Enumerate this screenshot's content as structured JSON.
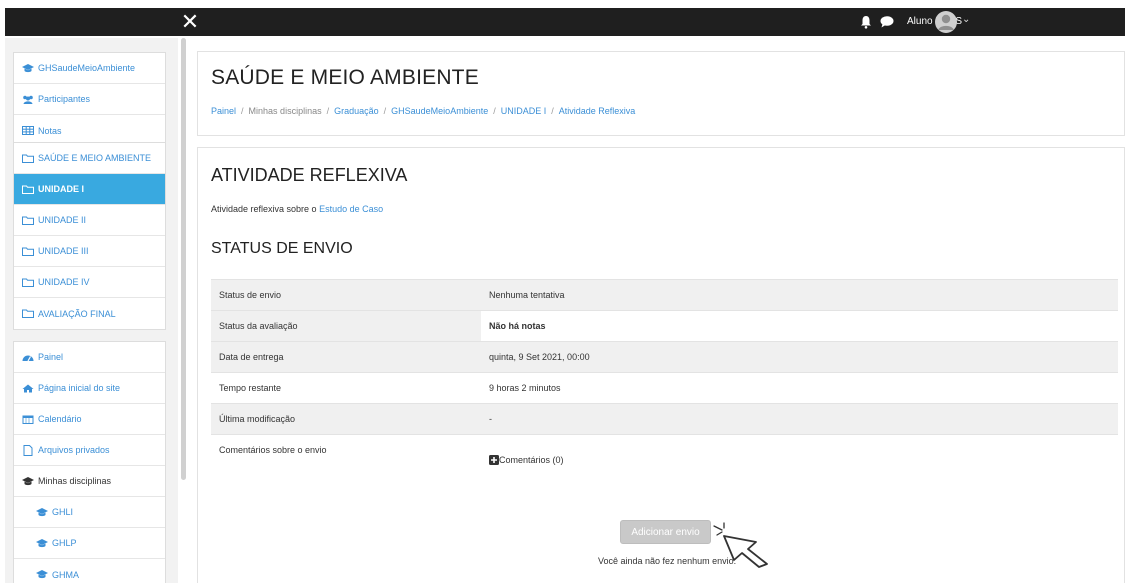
{
  "topbar": {
    "close_glyph": "✕",
    "user_name": "Aluno FPCS",
    "caret": "⌄",
    "icons": [
      "bell-icon",
      "chat-icon",
      "avatar-icon",
      "chevron-down-icon",
      "close-icon"
    ]
  },
  "sidebar": {
    "course_items": [
      {
        "label": "GHSaudeMeioAmbiente",
        "icon": "graduation-cap-icon"
      },
      {
        "label": "Participantes",
        "icon": "users-icon"
      },
      {
        "label": "Notas",
        "icon": "table-icon"
      },
      {
        "label": "SAÚDE E MEIO AMBIENTE",
        "icon": "folder-icon"
      },
      {
        "label": "UNIDADE I",
        "icon": "folder-icon",
        "active": true
      },
      {
        "label": "UNIDADE II",
        "icon": "folder-icon"
      },
      {
        "label": "UNIDADE III",
        "icon": "folder-icon"
      },
      {
        "label": "UNIDADE IV",
        "icon": "folder-icon"
      },
      {
        "label": "AVALIAÇÃO FINAL",
        "icon": "folder-icon"
      }
    ],
    "site_items": [
      {
        "label": "Painel",
        "icon": "dashboard-icon"
      },
      {
        "label": "Página inicial do site",
        "icon": "home-icon"
      },
      {
        "label": "Calendário",
        "icon": "calendar-icon"
      },
      {
        "label": "Arquivos privados",
        "icon": "file-icon"
      },
      {
        "label": "Minhas disciplinas",
        "icon": "graduation-cap-icon"
      },
      {
        "label": "GHLI",
        "icon": "graduation-cap-icon"
      },
      {
        "label": "GHLP",
        "icon": "graduation-cap-icon"
      },
      {
        "label": "GHMA",
        "icon": "graduation-cap-icon"
      }
    ]
  },
  "header": {
    "title": "SAÚDE E MEIO AMBIENTE",
    "breadcrumb": {
      "painel": "Painel",
      "minhas": "Minhas disciplinas",
      "graduacao": "Graduação",
      "course": "GHSaudeMeioAmbiente",
      "unit": "UNIDADE I",
      "activity": "Atividade Reflexiva",
      "separator": "/"
    }
  },
  "activity": {
    "title": "ATIVIDADE REFLEXIVA",
    "description_prefix": "Atividade reflexiva sobre o ",
    "description_link": "Estudo de Caso",
    "status_heading": "STATUS DE ENVIO",
    "status_rows": [
      {
        "label": "Status de envio",
        "value": "Nenhuma tentativa"
      },
      {
        "label": "Status da avaliação",
        "value": "Não há notas"
      },
      {
        "label": "Data de entrega",
        "value": "quinta, 9 Set 2021, 00:00"
      },
      {
        "label": "Tempo restante",
        "value": "9 horas 2 minutos"
      },
      {
        "label": "Última modificação",
        "value": "-"
      },
      {
        "label": "Comentários sobre o envio",
        "value": "Comentários (0)"
      }
    ],
    "add_button": "Adicionar envio",
    "submit_note": "Você ainda não fez nenhum envio."
  },
  "colors": {
    "topbar": "#1f1f1f",
    "accent": "#39a9e0",
    "link": "#3b8fd6",
    "button_disabled": "#c9c9c9"
  }
}
